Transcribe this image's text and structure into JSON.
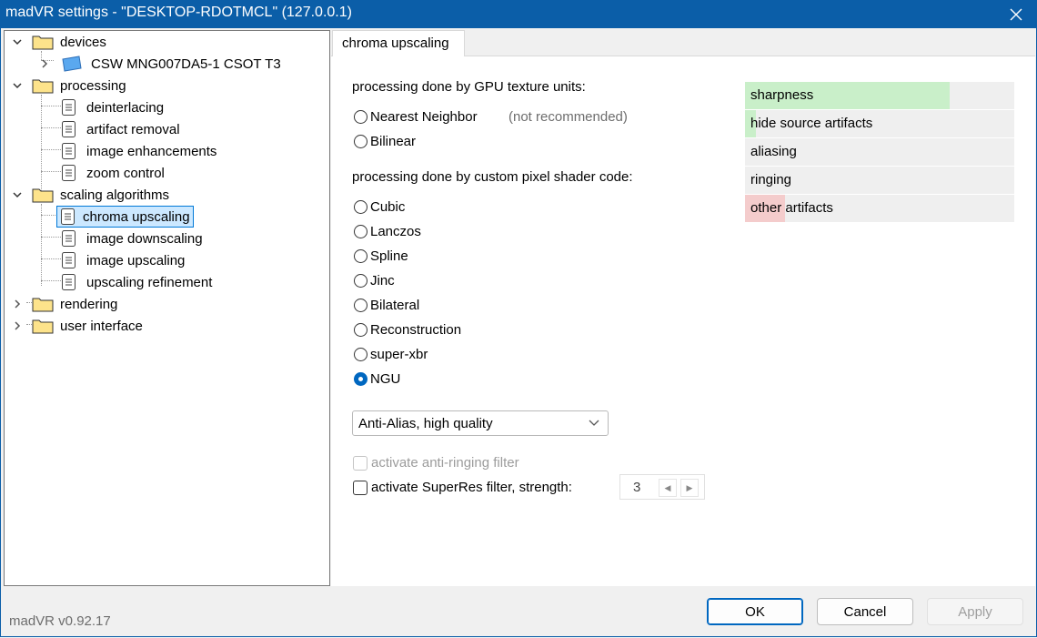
{
  "window": {
    "title": "madVR settings - \"DESKTOP-RDOTMCL\" (127.0.0.1)"
  },
  "tree": {
    "devices": "devices",
    "device_item": "CSW MNG007DA5-1 CSOT T3",
    "processing": "processing",
    "deinterlacing": "deinterlacing",
    "artifact_removal": "artifact removal",
    "image_enhancements": "image enhancements",
    "zoom_control": "zoom control",
    "scaling_algorithms": "scaling algorithms",
    "chroma_upscaling": "chroma upscaling",
    "image_downscaling": "image downscaling",
    "image_upscaling": "image upscaling",
    "upscaling_refinement": "upscaling refinement",
    "rendering": "rendering",
    "user_interface": "user interface"
  },
  "tab": {
    "label": "chroma upscaling"
  },
  "gpu_section": {
    "heading": "processing done by GPU texture units:",
    "nearest": "Nearest Neighbor",
    "not_recommended": "(not recommended)",
    "bilinear": "Bilinear"
  },
  "shader_section": {
    "heading": "processing done by custom pixel shader code:",
    "options": [
      "Cubic",
      "Lanczos",
      "Spline",
      "Jinc",
      "Bilateral",
      "Reconstruction",
      "super-xbr",
      "NGU"
    ],
    "selected": "NGU"
  },
  "quality_select": {
    "value": "Anti-Alias, high quality"
  },
  "anti_ringing": {
    "label": "activate anti-ringing filter",
    "checked": false,
    "enabled": false
  },
  "superres": {
    "label": "activate SuperRes filter, strength:",
    "checked": false,
    "strength": "3"
  },
  "quality_bars": {
    "sharpness": {
      "label": "sharpness",
      "level": 0.76,
      "color": "#c9efc9"
    },
    "hide_source_artifacts": {
      "label": "hide source artifacts",
      "level": 0.04,
      "color": "#c9efc9"
    },
    "aliasing": {
      "label": "aliasing",
      "level": 0.0,
      "color": "#f4cccc"
    },
    "ringing": {
      "label": "ringing",
      "level": 0.0,
      "color": "#f4cccc"
    },
    "other_artifacts": {
      "label": "other artifacts",
      "level": 0.15,
      "color": "#f4cccc"
    }
  },
  "footer": {
    "version": "madVR v0.92.17",
    "ok": "OK",
    "cancel": "Cancel",
    "apply": "Apply"
  }
}
